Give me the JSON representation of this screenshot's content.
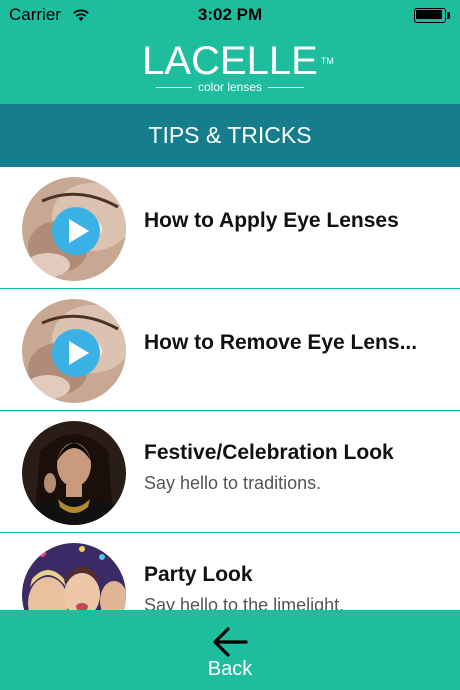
{
  "status_bar": {
    "carrier": "Carrier",
    "time": "3:02 PM"
  },
  "header": {
    "logo_text": "LACELLE",
    "logo_tm": "TM",
    "logo_subtitle": "color lenses"
  },
  "title_bar": {
    "title": "TIPS & TRICKS"
  },
  "list": {
    "items": [
      {
        "title": "How to Apply Eye Lenses",
        "subtitle": "",
        "thumbnail": "eye-lens-video",
        "has_play": true
      },
      {
        "title": "How to Remove Eye Lens...",
        "subtitle": "",
        "thumbnail": "eye-lens-video",
        "has_play": true
      },
      {
        "title": "Festive/Celebration Look",
        "subtitle": "Say hello to traditions.",
        "thumbnail": "festive-woman-photo",
        "has_play": false
      },
      {
        "title": "Party Look",
        "subtitle": "Say hello to the limelight.",
        "thumbnail": "party-group-photo",
        "has_play": false
      }
    ]
  },
  "bottom_bar": {
    "back_label": "Back"
  },
  "colors": {
    "teal": "#1ebd9e",
    "dark_teal": "#157d8c",
    "play_blue": "#3bb2e6"
  }
}
